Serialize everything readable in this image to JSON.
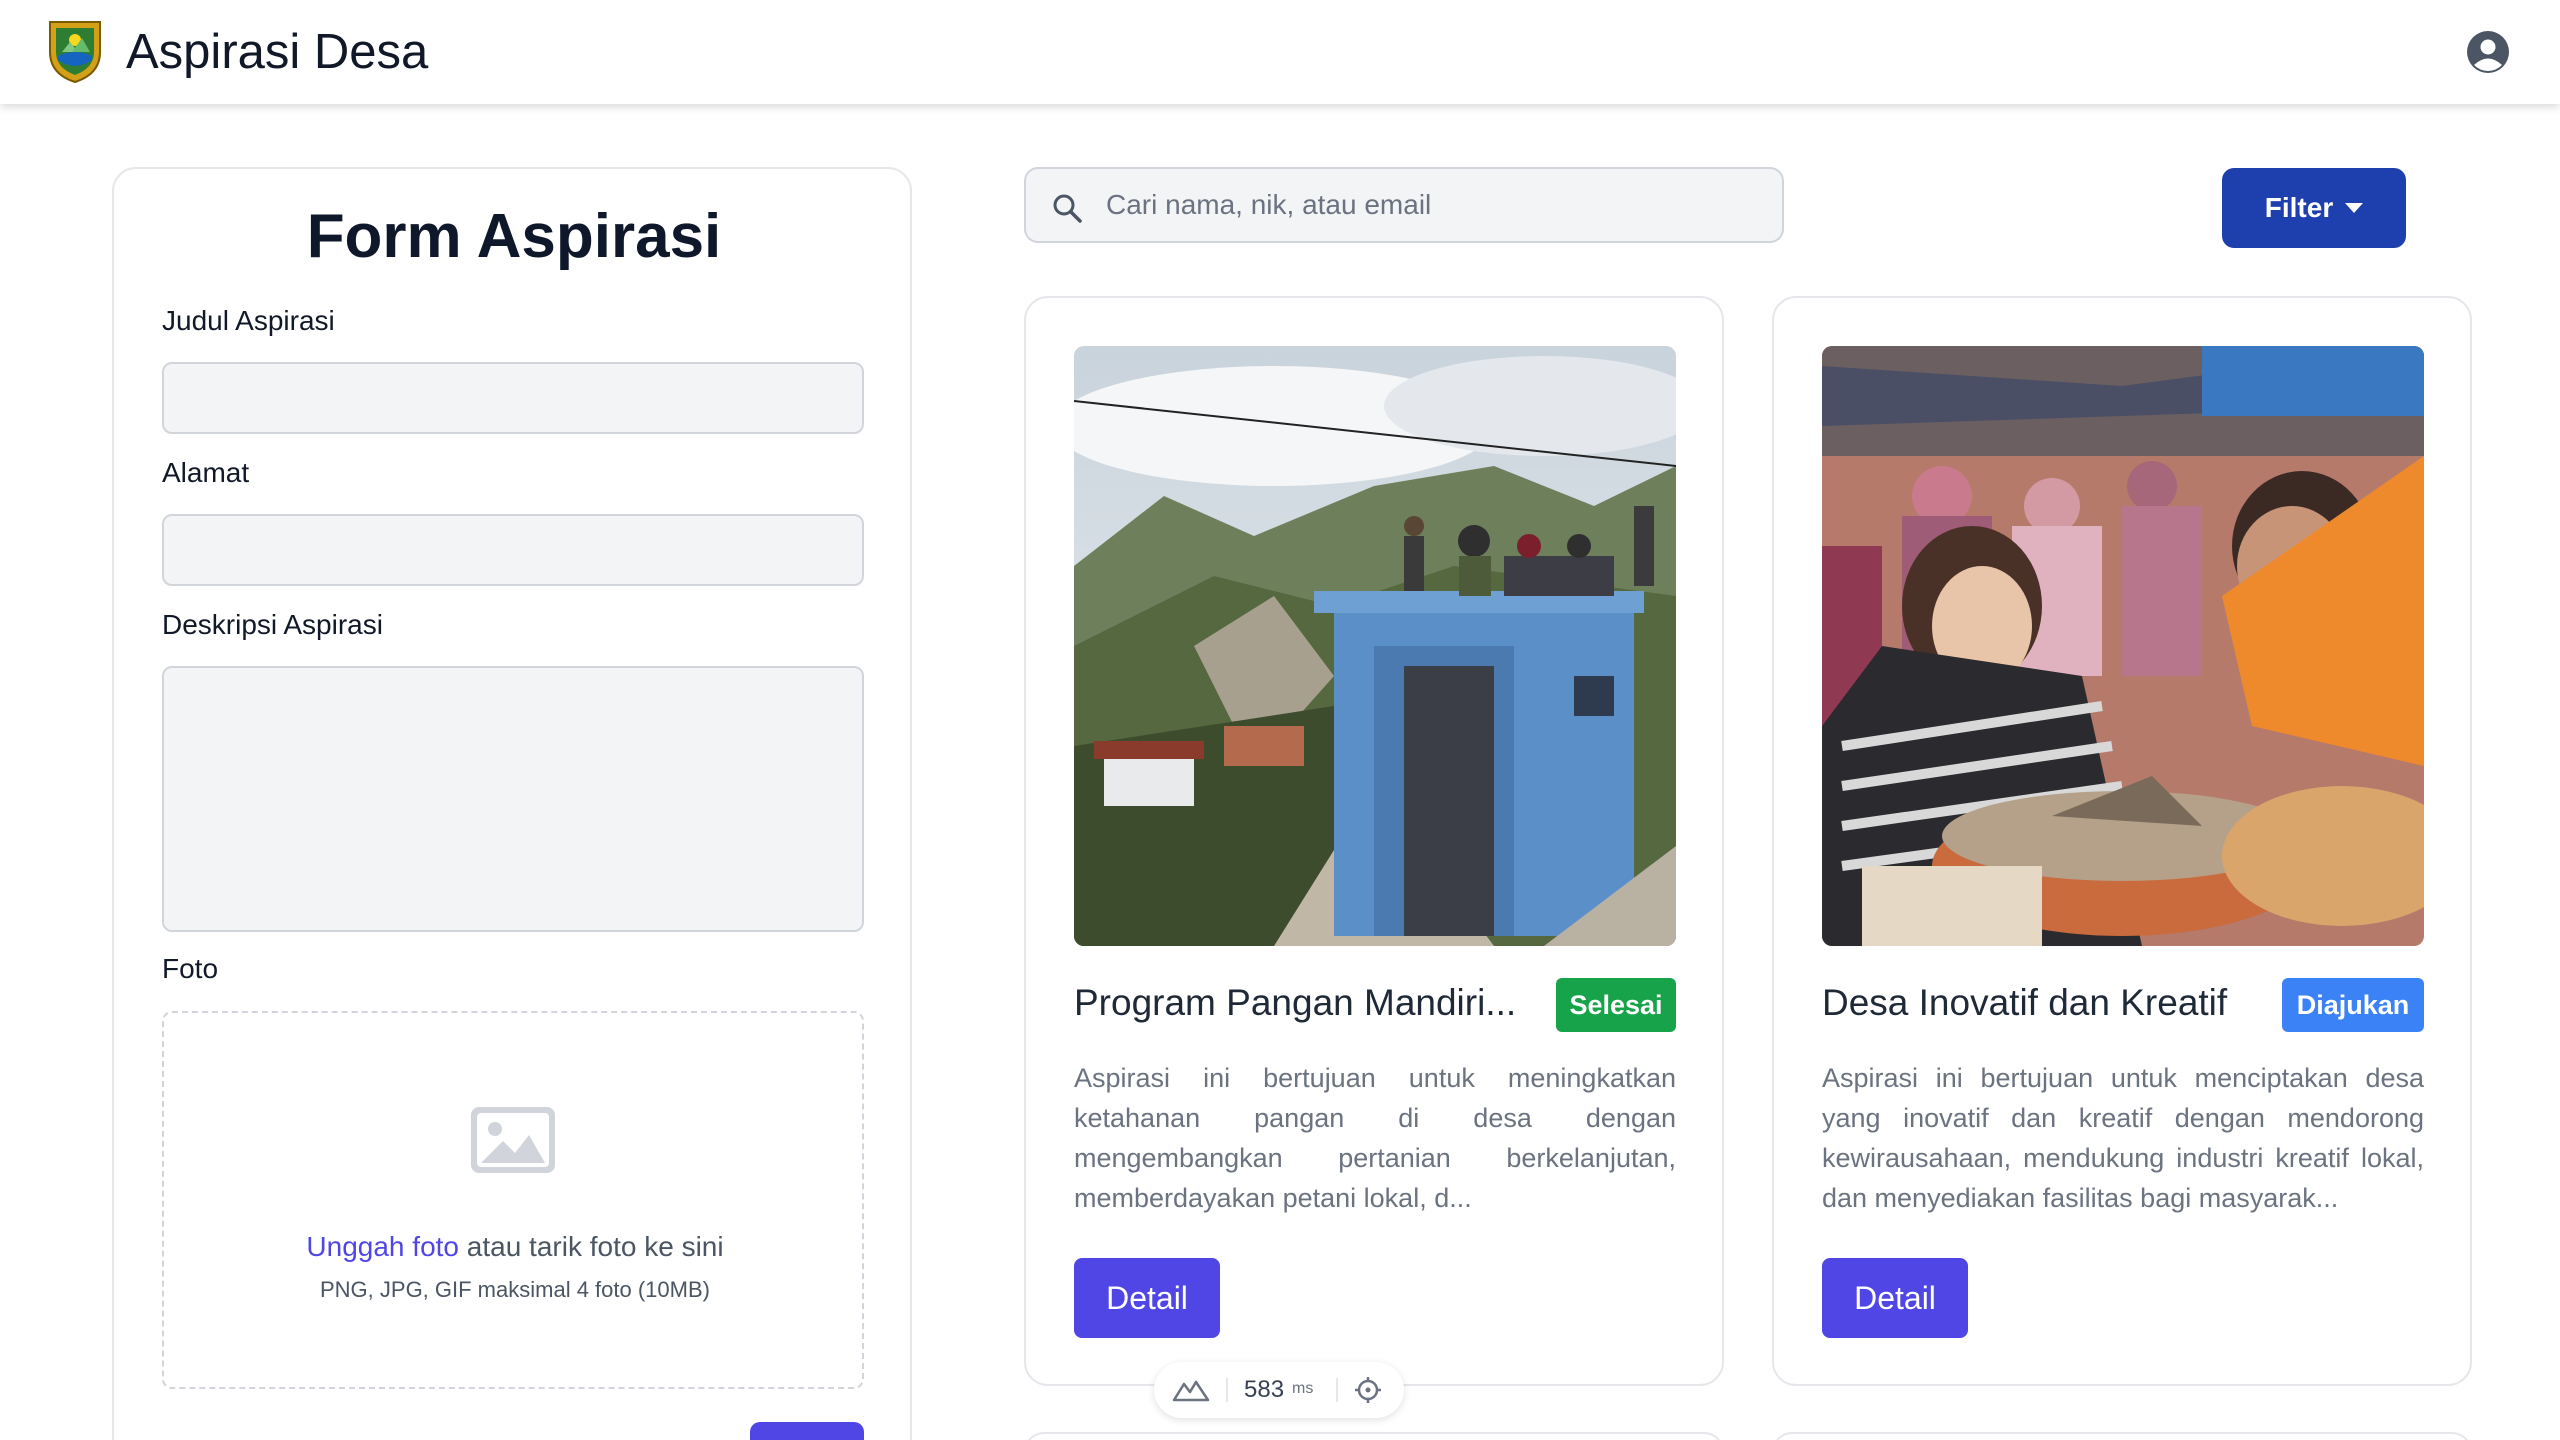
{
  "header": {
    "app_title": "Aspirasi Desa",
    "logo_icon": "village-crest-logo",
    "profile_icon": "user-circle-icon"
  },
  "form": {
    "title": "Form Aspirasi",
    "fields": {
      "judul_label": "Judul Aspirasi",
      "judul_value": "",
      "alamat_label": "Alamat",
      "alamat_value": "",
      "deskripsi_label": "Deskripsi Aspirasi",
      "deskripsi_value": "",
      "foto_label": "Foto"
    },
    "upload": {
      "link_text": "Unggah foto",
      "text_rest": " atau tarik foto ke sini",
      "hint": "PNG, JPG, GIF maksimal 4 foto (10MB)"
    }
  },
  "search": {
    "placeholder": "Cari nama, nik, atau email",
    "value": ""
  },
  "filter": {
    "label": "Filter"
  },
  "cards": [
    {
      "title": "Program Pangan Mandiri...",
      "status": "Selesai",
      "status_color": "#16a34a",
      "description": "Aspirasi ini bertujuan untuk meningkatkan ketahanan pangan di desa dengan mengembangkan pertanian berkelanjutan, memberdayakan petani lokal, d...",
      "button_label": "Detail"
    },
    {
      "title": "Desa Inovatif dan Kreatif",
      "status": "Diajukan",
      "status_color": "#3b82f6",
      "description": "Aspirasi ini bertujuan untuk menciptakan desa yang inovatif dan kreatif dengan mendorong kewirausahaan, mendukung industri kreatif lokal, dan menyediakan fasilitas bagi masyarak...",
      "button_label": "Detail"
    }
  ],
  "perf_widget": {
    "value": "583",
    "unit": "ms"
  },
  "colors": {
    "primary": "#4f46e5",
    "filter": "#1e40af"
  }
}
